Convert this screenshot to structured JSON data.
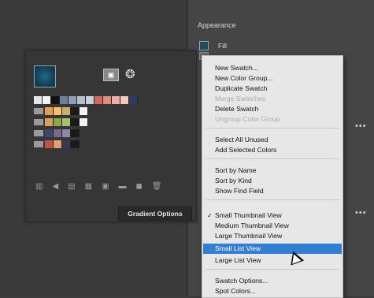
{
  "appearance": {
    "title": "Appearance",
    "fill_label": "Fill"
  },
  "swatch_panel": {
    "gradient_options_label": "Gradient Options",
    "rows": [
      [
        "#e6e6e6",
        "#f2f2f2",
        "#111111",
        "#6d7f9a",
        "#8e9fb8",
        "#b4c0d2",
        "#c8d2df",
        "#d06a5c",
        "#e08c7e",
        "#ecb0a6",
        "#f4c7be",
        "#2c3e66"
      ],
      [
        "#e8a050",
        "#f4c06a",
        "#c8b070",
        "#1a1a1a",
        "#f2f2f2"
      ],
      [
        "#d8a060",
        "#8aa84a",
        "#a8c06a",
        "#1a1a1a",
        "#f2f2f2"
      ],
      [
        "#3a4a6a",
        "#7a6a8a",
        "#8a8aa8",
        "#1a1a1a"
      ],
      [
        "#c05048",
        "#e0a070",
        "#3a3a4a",
        "#1a1a1a"
      ]
    ]
  },
  "menu": {
    "items": [
      {
        "label": "New Swatch...",
        "disabled": false
      },
      {
        "label": "New Color Group...",
        "disabled": false
      },
      {
        "label": "Duplicate Swatch",
        "disabled": false
      },
      {
        "label": "Merge Swatches",
        "disabled": true
      },
      {
        "label": "Delete Swatch",
        "disabled": false
      },
      {
        "label": "Ungroup Color Group",
        "disabled": true
      },
      {
        "label": "Select All Unused",
        "disabled": false
      },
      {
        "label": "Add Selected Colors",
        "disabled": false
      },
      {
        "label": "Sort by Name",
        "disabled": false
      },
      {
        "label": "Sort by Kind",
        "disabled": false
      },
      {
        "label": "Show Find Field",
        "disabled": false
      },
      {
        "label": "Small Thumbnail View",
        "disabled": false,
        "checked": true
      },
      {
        "label": "Medium Thumbnail View",
        "disabled": false
      },
      {
        "label": "Large Thumbnail View",
        "disabled": false
      },
      {
        "label": "Small List View",
        "disabled": false,
        "highlighted": true
      },
      {
        "label": "Large List View",
        "disabled": false
      },
      {
        "label": "Swatch Options...",
        "disabled": false
      },
      {
        "label": "Spot Colors...",
        "disabled": false
      }
    ]
  },
  "colors": {
    "highlight": "#2f7fd2",
    "menu_bg": "#e7e7e7"
  }
}
